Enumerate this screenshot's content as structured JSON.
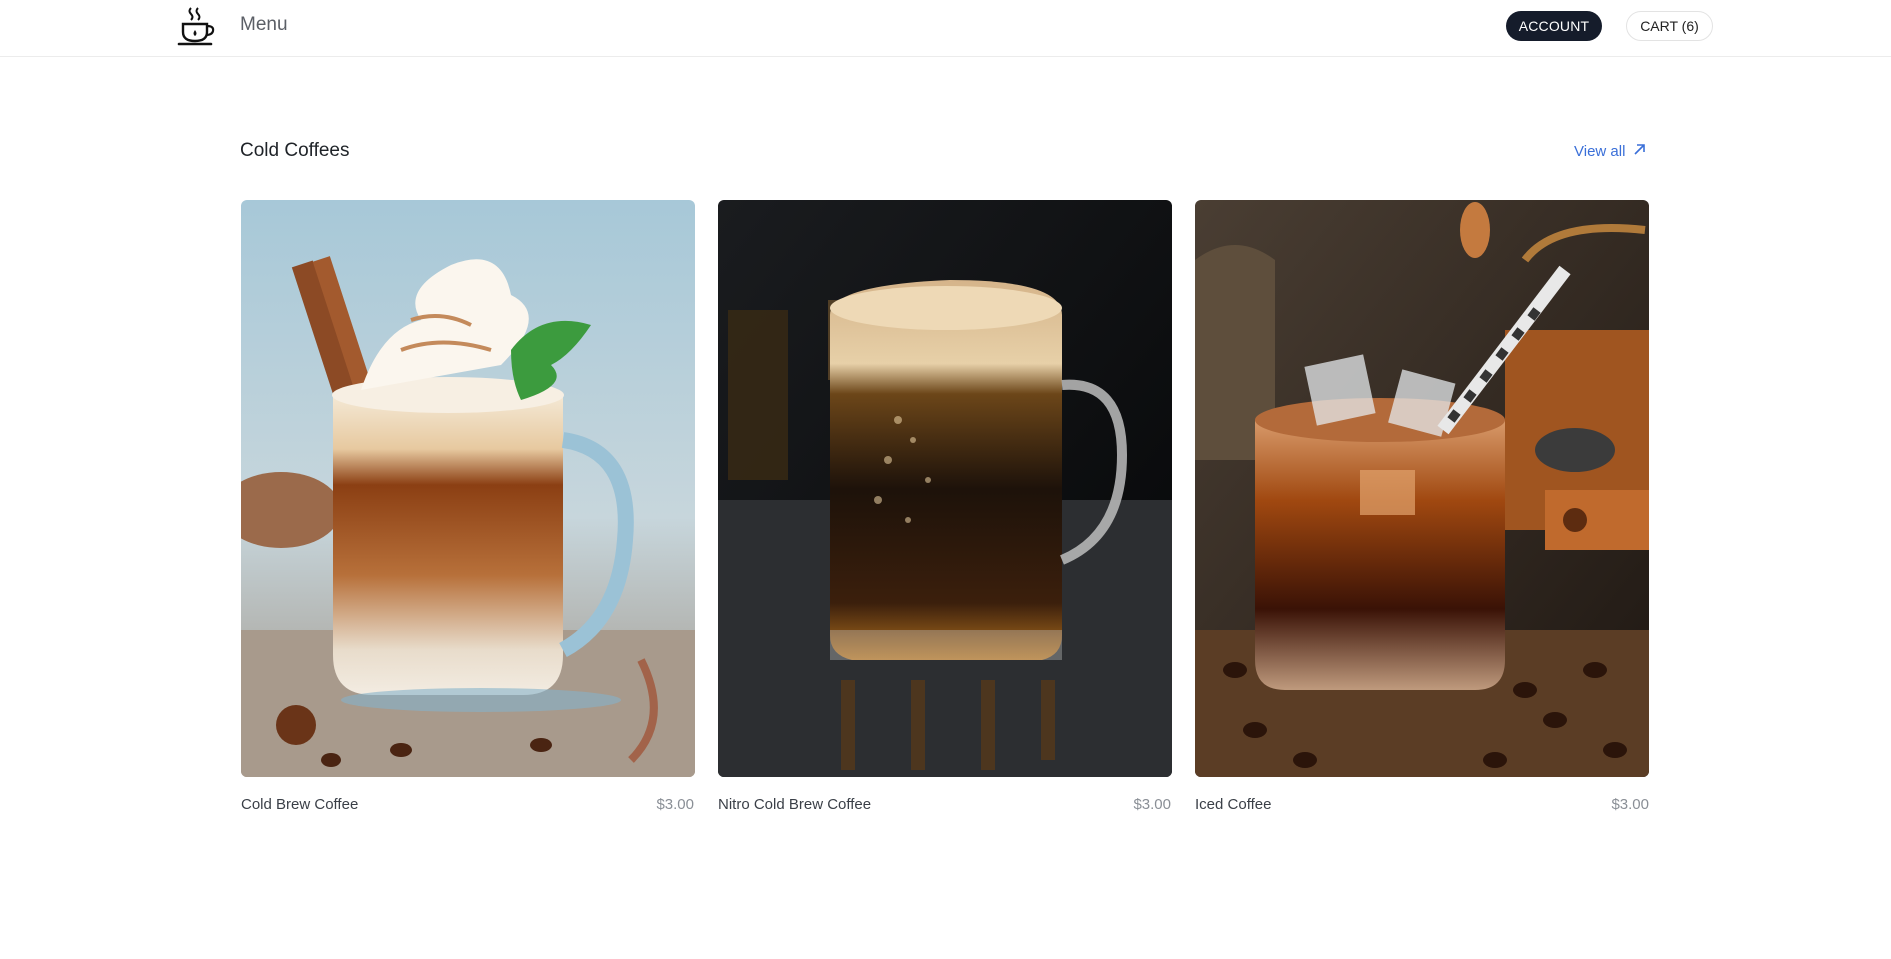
{
  "header": {
    "logo_icon": "coffee-cup-icon",
    "menu_label": "Menu",
    "account_label": "ACCOUNT",
    "cart_label": "CART (6)"
  },
  "section": {
    "title": "Cold Coffees",
    "view_all_label": "View all",
    "view_all_icon": "arrow-up-right-icon"
  },
  "products": [
    {
      "name": "Cold Brew Coffee",
      "price": "$3.00",
      "image": "cold-brew-coffee-photo"
    },
    {
      "name": "Nitro Cold Brew Coffee",
      "price": "$3.00",
      "image": "nitro-cold-brew-photo"
    },
    {
      "name": "Iced Coffee",
      "price": "$3.00",
      "image": "iced-coffee-photo"
    }
  ],
  "colors": {
    "account_bg": "#151c2b",
    "link": "#3a6fd8",
    "price": "#8a8f96"
  }
}
